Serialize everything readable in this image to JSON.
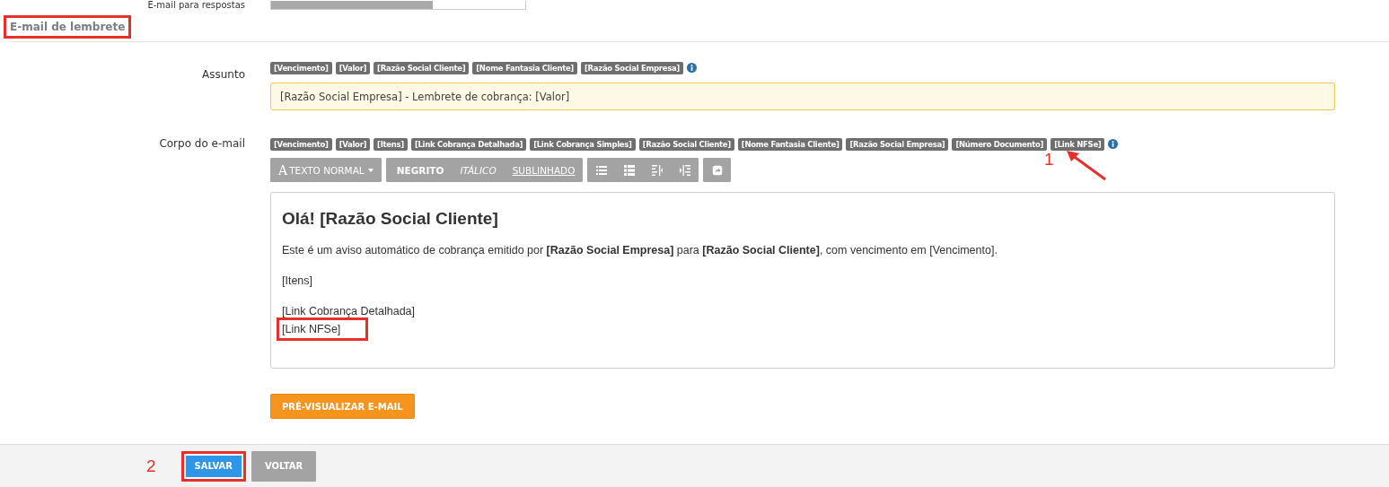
{
  "previous_field": {
    "label": "E-mail para respostas"
  },
  "section": {
    "title": "E-mail de lembrete",
    "highlighted": true
  },
  "subject": {
    "label": "Assunto",
    "tags": [
      "[Vencimento]",
      "[Valor]",
      "[Razão Social Cliente]",
      "[Nome Fantasia Cliente]",
      "[Razão Social Empresa]"
    ],
    "value": "[Razão Social Empresa] - Lembrete de cobrança: [Valor]"
  },
  "body": {
    "label": "Corpo do e-mail",
    "tags": [
      "[Vencimento]",
      "[Valor]",
      "[Itens]",
      "[Link Cobrança Detalhada]",
      "[Link Cobrança Simples]",
      "[Razão Social Cliente]",
      "[Nome Fantasia Cliente]",
      "[Razão Social Empresa]",
      "[Número Documento]",
      "[Link NFSe]"
    ],
    "toolbar": {
      "style_button": {
        "icon": "A",
        "label": "TEXTO NORMAL"
      },
      "format_buttons": [
        {
          "kind": "bold",
          "label": "NEGRITO"
        },
        {
          "kind": "italic",
          "label": "ITÁLICO"
        },
        {
          "kind": "underline",
          "label": "SUBLINHADO"
        }
      ],
      "list_buttons": [
        {
          "kind": "bullets"
        },
        {
          "kind": "numbers"
        },
        {
          "kind": "outdent"
        },
        {
          "kind": "indent"
        }
      ],
      "extra_buttons": [
        {
          "kind": "share"
        }
      ]
    },
    "content": [
      {
        "kind": "heading",
        "text": "Olá! [Razão Social Cliente]",
        "highlighted": false
      },
      {
        "kind": "paragraph",
        "text": "Este é um aviso automático de cobrança emitido por **[Razão Social Empresa]** para **[Razão Social Cliente]**, com vencimento em [Vencimento].",
        "highlighted": false
      },
      {
        "kind": "paragraph",
        "text": "[Itens]",
        "highlighted": false
      },
      {
        "kind": "line",
        "text": "[Link Cobrança Detalhada]",
        "highlighted": false
      },
      {
        "kind": "line",
        "text": "[Link NFSe]",
        "highlighted": true
      }
    ]
  },
  "preview_button": "PRÉ-VISUALIZAR E-MAIL",
  "footer": {
    "marker": "2",
    "buttons": [
      {
        "kind": "primary",
        "label": "SALVAR",
        "highlighted": true
      },
      {
        "kind": "default",
        "label": "VOLTAR",
        "highlighted": false
      }
    ]
  },
  "annotation": {
    "marker": "1"
  }
}
